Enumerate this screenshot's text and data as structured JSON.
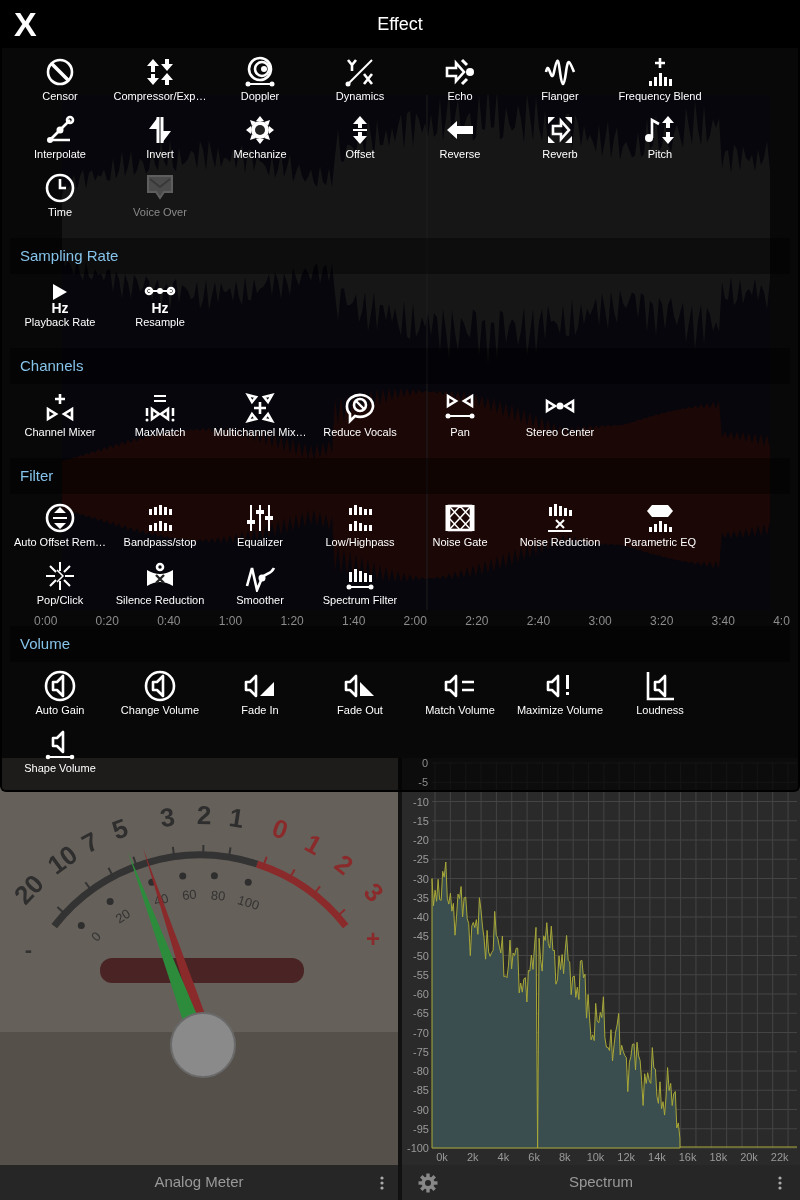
{
  "dialog": {
    "title": "Effect",
    "close": "X"
  },
  "sections": [
    {
      "items": [
        {
          "label": "Censor",
          "disabled": false
        },
        {
          "label": "Compressor/Exp…",
          "disabled": false
        },
        {
          "label": "Doppler",
          "disabled": false
        },
        {
          "label": "Dynamics",
          "disabled": false
        },
        {
          "label": "Echo",
          "disabled": false
        },
        {
          "label": "Flanger",
          "disabled": false
        },
        {
          "label": "Frequency Blend",
          "disabled": false
        },
        {
          "label": "Interpolate",
          "disabled": false
        },
        {
          "label": "Invert",
          "disabled": false
        },
        {
          "label": "Mechanize",
          "disabled": false
        },
        {
          "label": "Offset",
          "disabled": false
        },
        {
          "label": "Reverse",
          "disabled": false
        },
        {
          "label": "Reverb",
          "disabled": false
        },
        {
          "label": "Pitch",
          "disabled": false
        },
        {
          "label": "Time",
          "disabled": false
        },
        {
          "label": "Voice Over",
          "disabled": true
        }
      ]
    },
    {
      "heading": "Sampling Rate",
      "items": [
        {
          "label": "Playback Rate",
          "disabled": false,
          "icon_text": "Hz"
        },
        {
          "label": "Resample",
          "disabled": false,
          "icon_text": "Hz"
        }
      ]
    },
    {
      "heading": "Channels",
      "items": [
        {
          "label": "Channel Mixer",
          "disabled": false
        },
        {
          "label": "MaxMatch",
          "disabled": false
        },
        {
          "label": "Multichannel Mix…",
          "disabled": false
        },
        {
          "label": "Reduce Vocals",
          "disabled": false
        },
        {
          "label": "Pan",
          "disabled": false
        },
        {
          "label": "Stereo Center",
          "disabled": false
        }
      ]
    },
    {
      "heading": "Filter",
      "items": [
        {
          "label": "Auto Offset Rem…",
          "disabled": false
        },
        {
          "label": "Bandpass/stop",
          "disabled": false
        },
        {
          "label": "Equalizer",
          "disabled": false
        },
        {
          "label": "Low/Highpass",
          "disabled": false
        },
        {
          "label": "Noise Gate",
          "disabled": false
        },
        {
          "label": "Noise Reduction",
          "disabled": false
        },
        {
          "label": "Parametric EQ",
          "disabled": false
        },
        {
          "label": "Pop/Click",
          "disabled": false
        },
        {
          "label": "Silence Reduction",
          "disabled": false
        },
        {
          "label": "Smoother",
          "disabled": false
        },
        {
          "label": "Spectrum Filter",
          "disabled": false
        }
      ]
    },
    {
      "heading": "Volume",
      "items": [
        {
          "label": "Auto Gain",
          "disabled": false
        },
        {
          "label": "Change Volume",
          "disabled": false
        },
        {
          "label": "Fade In",
          "disabled": false
        },
        {
          "label": "Fade Out",
          "disabled": false
        },
        {
          "label": "Match Volume",
          "disabled": false
        },
        {
          "label": "Maximize Volume",
          "disabled": false
        },
        {
          "label": "Loudness",
          "disabled": false
        },
        {
          "label": "Shape Volume",
          "disabled": false
        }
      ]
    }
  ],
  "timeline": {
    "ticks": [
      "0:00",
      "0:20",
      "0:40",
      "1:00",
      "1:20",
      "1:40",
      "2:00",
      "2:20",
      "2:40",
      "3:00",
      "3:20",
      "3:40",
      "4:0"
    ]
  },
  "analog_meter": {
    "title": "Analog Meter",
    "vu_scale": [
      "20",
      "10",
      "7",
      "5",
      "3",
      "2",
      "1",
      "0",
      "1",
      "2",
      "3"
    ],
    "percent_scale": [
      "0",
      "20",
      "40",
      "60",
      "80",
      "100"
    ],
    "minus": "-",
    "plus": "+"
  },
  "spectrum": {
    "title": "Spectrum",
    "y_ticks": [
      "0",
      "-5",
      "-10",
      "-15",
      "-20",
      "-25",
      "-30",
      "-35",
      "-40",
      "-45",
      "-50",
      "-55",
      "-60",
      "-65",
      "-70",
      "-75",
      "-80",
      "-85",
      "-90",
      "-95",
      "-100"
    ],
    "x_ticks": [
      "0k",
      "2k",
      "4k",
      "6k",
      "8k",
      "10k",
      "12k",
      "14k",
      "16k",
      "18k",
      "20k",
      "22k"
    ]
  }
}
